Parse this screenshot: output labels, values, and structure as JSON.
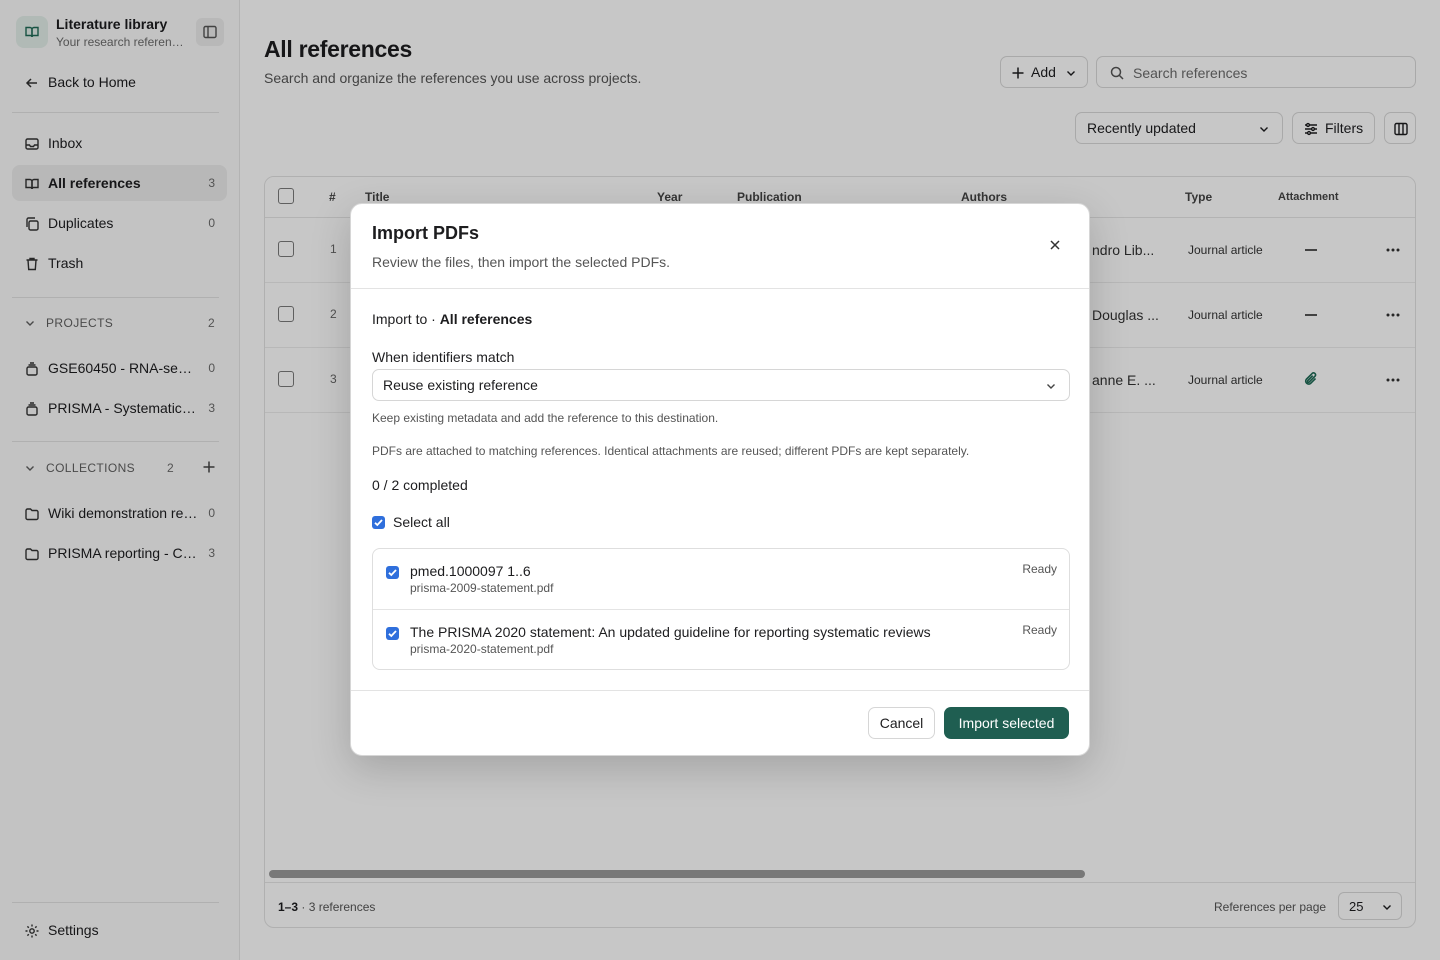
{
  "sidebar": {
    "library_title": "Literature library",
    "library_subtitle": "Your research references",
    "back_label": "Back to Home",
    "nav": [
      {
        "label": "Inbox",
        "count": ""
      },
      {
        "label": "All references",
        "count": "3"
      },
      {
        "label": "Duplicates",
        "count": "0"
      },
      {
        "label": "Trash",
        "count": ""
      }
    ],
    "projects": {
      "title": "PROJECTS",
      "count": "2",
      "items": [
        {
          "label": "GSE60450 - RNA-seq analysis",
          "count": "0"
        },
        {
          "label": "PRISMA - Systematic review",
          "count": "3"
        }
      ]
    },
    "collections": {
      "title": "COLLECTIONS",
      "count": "2",
      "items": [
        {
          "label": "Wiki demonstration references",
          "count": "0"
        },
        {
          "label": "PRISMA reporting - Checklist",
          "count": "3"
        }
      ]
    },
    "settings_label": "Settings"
  },
  "header": {
    "title": "All references",
    "subtitle": "Search and organize the references you use across projects.",
    "add_label": "Add",
    "search_placeholder": "Search references",
    "sort_label": "Recently updated",
    "filters_label": "Filters"
  },
  "table": {
    "columns": {
      "num": "#",
      "title": "Title",
      "year": "Year",
      "publication": "Publication",
      "authors": "Authors",
      "type": "Type",
      "attachment": "Attachment"
    },
    "rows": [
      {
        "num": "1",
        "authors": "ndro Lib...",
        "type": "Journal article",
        "attachment": false
      },
      {
        "num": "2",
        "authors": "Douglas ...",
        "type": "Journal article",
        "attachment": false
      },
      {
        "num": "3",
        "authors": "anne E. ...",
        "type": "Journal article",
        "attachment": true
      }
    ],
    "footer": {
      "range": "1–3",
      "total": "· 3 references",
      "per_page_label": "References per page",
      "per_page_value": "25"
    }
  },
  "modal": {
    "title": "Import PDFs",
    "subtitle": "Review the files, then import the selected PDFs.",
    "import_to_label": "Import to ·",
    "import_to_value": "All references",
    "identifiers_label": "When identifiers match",
    "identifiers_value": "Reuse existing reference",
    "identifiers_hint": "Keep existing metadata and add the reference to this destination.",
    "attach_hint": "PDFs are attached to matching references. Identical attachments are reused; different PDFs are kept separately.",
    "progress": "0 / 2 completed",
    "select_all_label": "Select all",
    "files": [
      {
        "title": "pmed.1000097 1..6",
        "filename": "prisma-2009-statement.pdf",
        "status": "Ready"
      },
      {
        "title": "The PRISMA 2020 statement: An updated guideline for reporting systematic reviews",
        "filename": "prisma-2020-statement.pdf",
        "status": "Ready"
      }
    ],
    "cancel_label": "Cancel",
    "import_label": "Import selected"
  },
  "colors": {
    "accent": "#1f5e51",
    "checkbox": "#2f6fdc",
    "active_nav": "#ececec"
  }
}
